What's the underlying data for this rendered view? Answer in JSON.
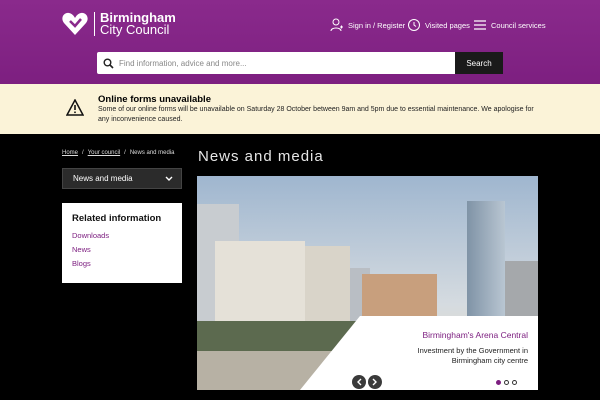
{
  "header": {
    "logo_line1": "Birmingham",
    "logo_line2": "City Council",
    "sign_in": "Sign in / Register",
    "visited": "Visited pages",
    "services": "Council services"
  },
  "search": {
    "placeholder": "Find information, advice and more...",
    "button": "Search"
  },
  "alert": {
    "title": "Online forms unavailable",
    "text": "Some of our online forms will be unavailable on Saturday 28 October between 9am and 5pm due to essential maintenance. We apologise for any inconvenience caused."
  },
  "breadcrumb": {
    "home": "Home",
    "council": "Your council",
    "current": "News and media"
  },
  "page_title": "News and media",
  "sidebar": {
    "select_label": "News and media",
    "related_title": "Related information",
    "links": [
      "Downloads",
      "News",
      "Blogs"
    ]
  },
  "hero": {
    "caption_title": "Birmingham's Arena Central",
    "caption_text": "Investment by the Government in Birmingham city centre"
  },
  "colors": {
    "brand": "#7d1f80",
    "alert_bg": "#fbf3d8"
  }
}
